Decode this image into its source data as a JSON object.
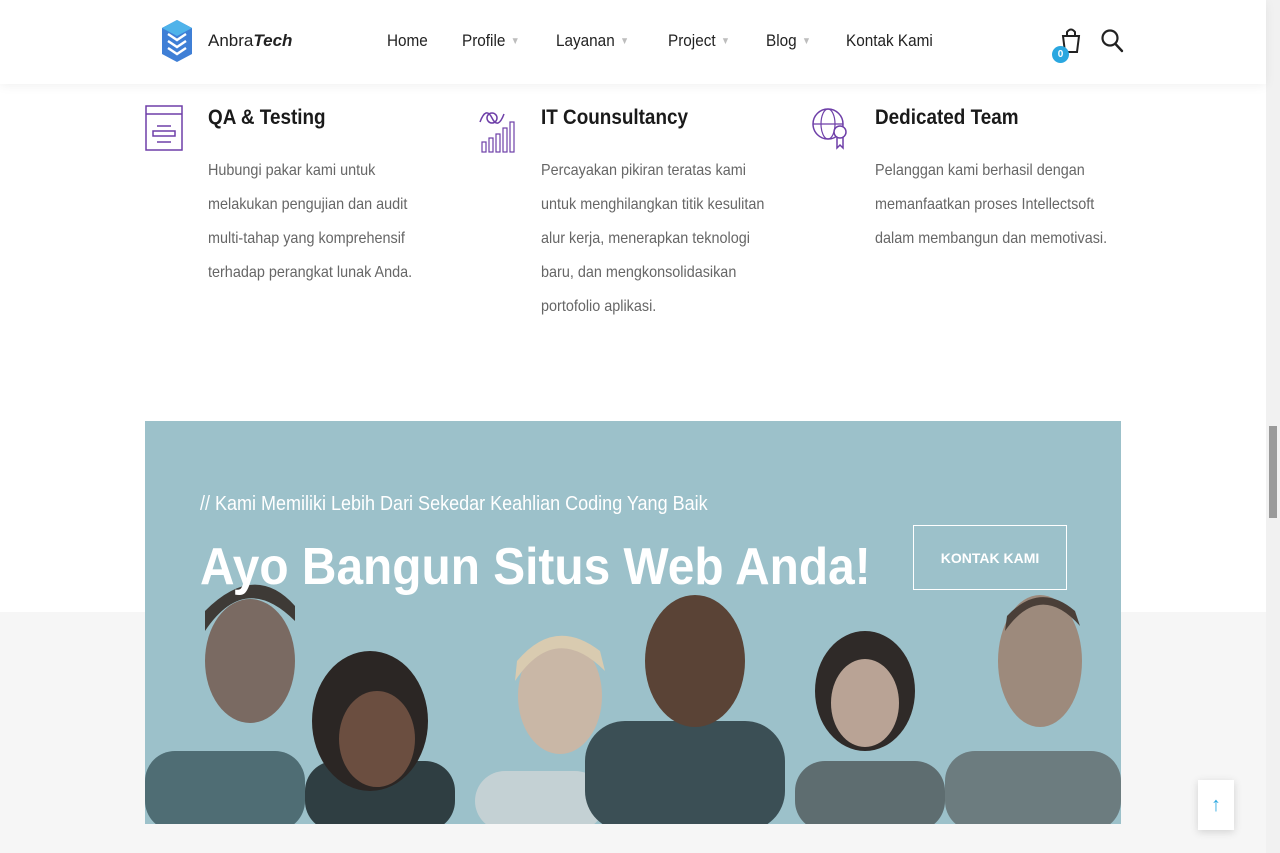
{
  "brand": {
    "name_regular": "Anbra",
    "name_bold": "Tech",
    "accent": "#2aa7e0"
  },
  "nav": {
    "items": [
      {
        "label": "Home",
        "has_dropdown": false
      },
      {
        "label": "Profile",
        "has_dropdown": true
      },
      {
        "label": "Layanan",
        "has_dropdown": true
      },
      {
        "label": "Project",
        "has_dropdown": true
      },
      {
        "label": "Blog",
        "has_dropdown": true
      },
      {
        "label": "Kontak Kami",
        "has_dropdown": false
      }
    ],
    "cart_count": "0",
    "caret": "▼"
  },
  "services": [
    {
      "icon": "qa-testing-icon",
      "title": "QA & Testing",
      "description": "Hubungi pakar kami untuk melakukan pengujian dan audit multi-tahap yang komprehensif terhadap perangkat lunak Anda."
    },
    {
      "icon": "it-consultancy-icon",
      "title": "IT Counsultancy",
      "description": "Percayakan pikiran teratas kami untuk menghilangkan titik kesulitan alur kerja, menerapkan teknologi baru, dan mengkonsolidasikan portofolio aplikasi."
    },
    {
      "icon": "dedicated-team-icon",
      "title": "Dedicated Team",
      "description": "Pelanggan kami berhasil dengan memanfaatkan proses Intellectsoft dalam membangun dan memotivasi."
    }
  ],
  "banner": {
    "subtitle": "// Kami Memiliki Lebih Dari Sekedar Keahlian Coding Yang Baik",
    "headline": "Ayo Bangun Situs Web Anda!",
    "cta_label": "KONTAK KAMI",
    "background": "#9cc1ca"
  },
  "back_to_top": "↑"
}
